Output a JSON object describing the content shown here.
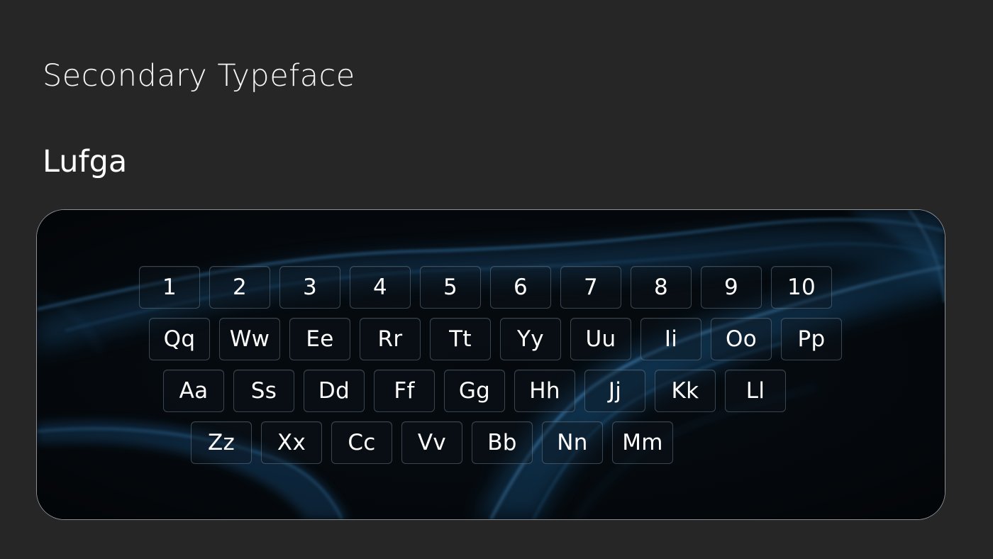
{
  "heading": "Secondary Typeface",
  "font_name": "Lufga",
  "colors": {
    "page_background": "#262626",
    "text": "#ffffff",
    "panel_background": "#04080c",
    "smoke_accent": "#2f86c8"
  },
  "keyboard": {
    "rows": [
      [
        "1",
        "2",
        "3",
        "4",
        "5",
        "6",
        "7",
        "8",
        "9",
        "10"
      ],
      [
        "Qq",
        "Ww",
        "Ee",
        "Rr",
        "Tt",
        "Yy",
        "Uu",
        "Ii",
        "Oo",
        "Pp"
      ],
      [
        "Aa",
        "Ss",
        "Dd",
        "Ff",
        "Gg",
        "Hh",
        "Jj",
        "Kk",
        "Ll"
      ],
      [
        "Zz",
        "Xx",
        "Cc",
        "Vv",
        "Bb",
        "Nn",
        "Mm"
      ]
    ]
  }
}
